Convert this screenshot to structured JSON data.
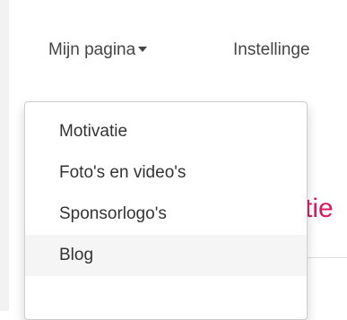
{
  "nav": {
    "my_page_label": "Mijn pagina",
    "settings_label": "Instellinge"
  },
  "dropdown": {
    "items": [
      {
        "label": "Motivatie"
      },
      {
        "label": "Foto's en video's"
      },
      {
        "label": "Sponsorlogo's"
      },
      {
        "label": "Blog"
      }
    ]
  },
  "page": {
    "partial_heading": "ctie"
  },
  "colors": {
    "heading_accent": "#d81b60",
    "hover_background": "#f5f5f5"
  }
}
